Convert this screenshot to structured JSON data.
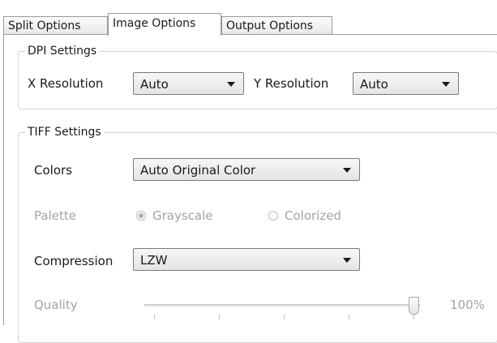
{
  "tabs": [
    {
      "label": "Split Options",
      "active": false
    },
    {
      "label": "Image Options",
      "active": true
    },
    {
      "label": "Output Options",
      "active": false
    }
  ],
  "dpi": {
    "title": "DPI Settings",
    "x_label": "X Resolution",
    "x_value": "Auto",
    "y_label": "Y Resolution",
    "y_value": "Auto"
  },
  "tiff": {
    "title": "TIFF Settings",
    "colors_label": "Colors",
    "colors_value": "Auto Original Color",
    "palette_label": "Palette",
    "palette_options": [
      {
        "label": "Grayscale",
        "selected": true
      },
      {
        "label": "Colorized",
        "selected": false
      }
    ],
    "compression_label": "Compression",
    "compression_value": "LZW",
    "quality_label": "Quality",
    "quality_value": 100,
    "quality_text": "100%"
  }
}
